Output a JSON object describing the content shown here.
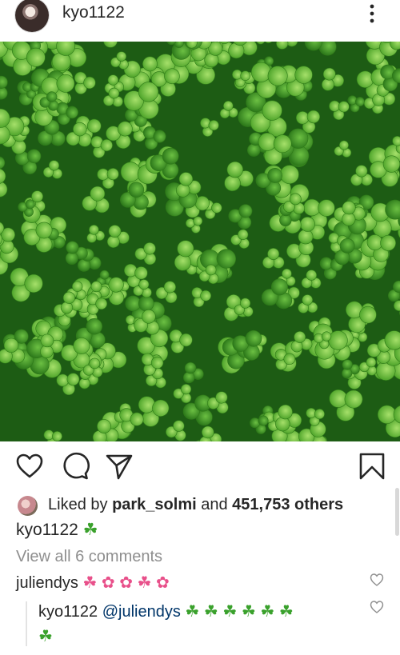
{
  "post": {
    "author": "kyo1122"
  },
  "likes": {
    "prefix": "Liked by ",
    "liker": "park_solmi",
    "middle": " and ",
    "count": "451,753 others"
  },
  "caption": {
    "username": "kyo1122",
    "text": "☘"
  },
  "comments": {
    "view_all": "View all 6 comments",
    "first": {
      "username": "juliendys",
      "text": "☘ ✿ ✿ ☘ ✿"
    },
    "reply": {
      "username": "kyo1122",
      "mention": "@juliendys",
      "text": "☘ ☘ ☘ ☘ ☘ ☘",
      "overflow": "☘"
    }
  },
  "colors": {
    "text": "#262626",
    "muted": "#8e8e8e",
    "mention": "#003569",
    "clover": "#3aa12c",
    "flower": "#e8508a"
  },
  "icons": [
    "more-vertical-icon",
    "heart-icon",
    "comment-icon",
    "share-icon",
    "bookmark-icon",
    "small-heart-icon"
  ]
}
